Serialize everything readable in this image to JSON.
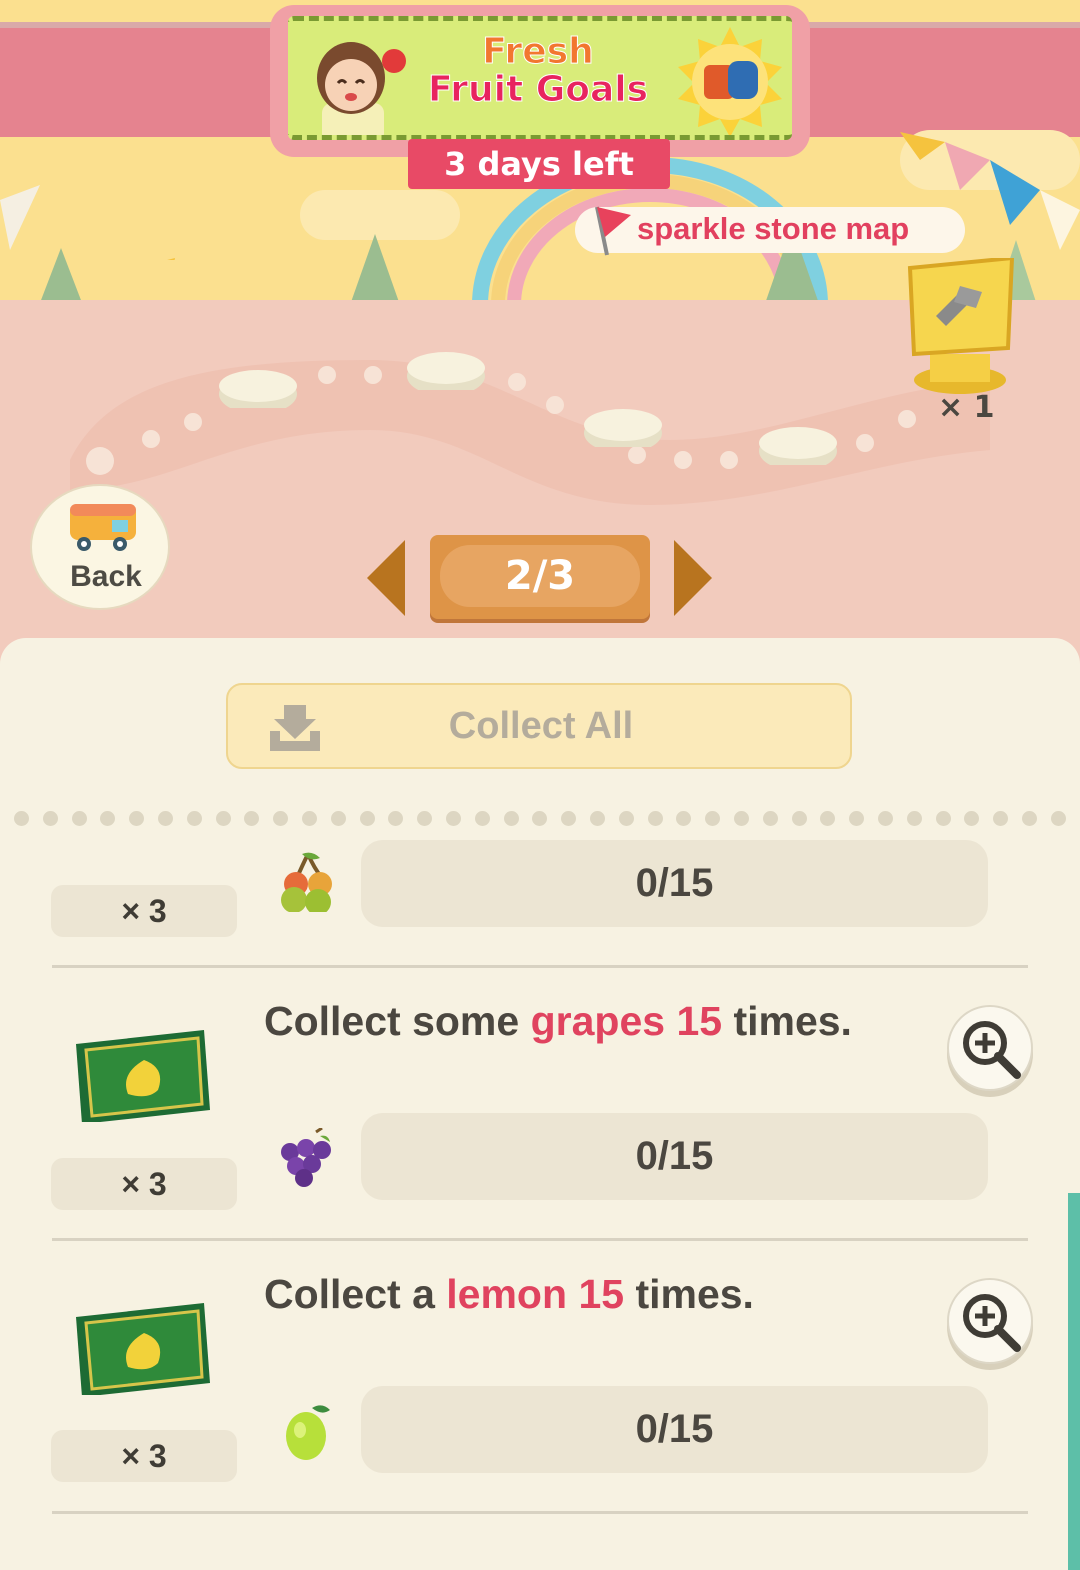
{
  "event": {
    "title_line1": "Fresh",
    "title_line2": "Fruit Goals",
    "days_left": "3 days left"
  },
  "map": {
    "label": "sparkle stone map",
    "count": "× 1"
  },
  "nav": {
    "back_label": "Back",
    "page_indicator": "2/3"
  },
  "panel": {
    "collect_all_label": "Collect All",
    "missions": [
      {
        "reward_qty": "× 3",
        "progress": "0/15",
        "fruit_icon": "cherry-icon"
      },
      {
        "text_before": "Collect some ",
        "text_fruit": "grapes",
        "text_count": "15",
        "text_after": " times.",
        "reward_qty": "× 3",
        "progress": "0/15",
        "fruit_icon": "grape-icon"
      },
      {
        "text_before": "Collect a ",
        "text_fruit": "lemon",
        "text_count": "15",
        "text_after": " times.",
        "reward_qty": "× 3",
        "progress": "0/15",
        "fruit_icon": "lemon-icon"
      }
    ]
  },
  "colors": {
    "accent_pink": "#e0435f",
    "panel_bg": "#f7f2e2",
    "pager_orange": "#de9447"
  }
}
